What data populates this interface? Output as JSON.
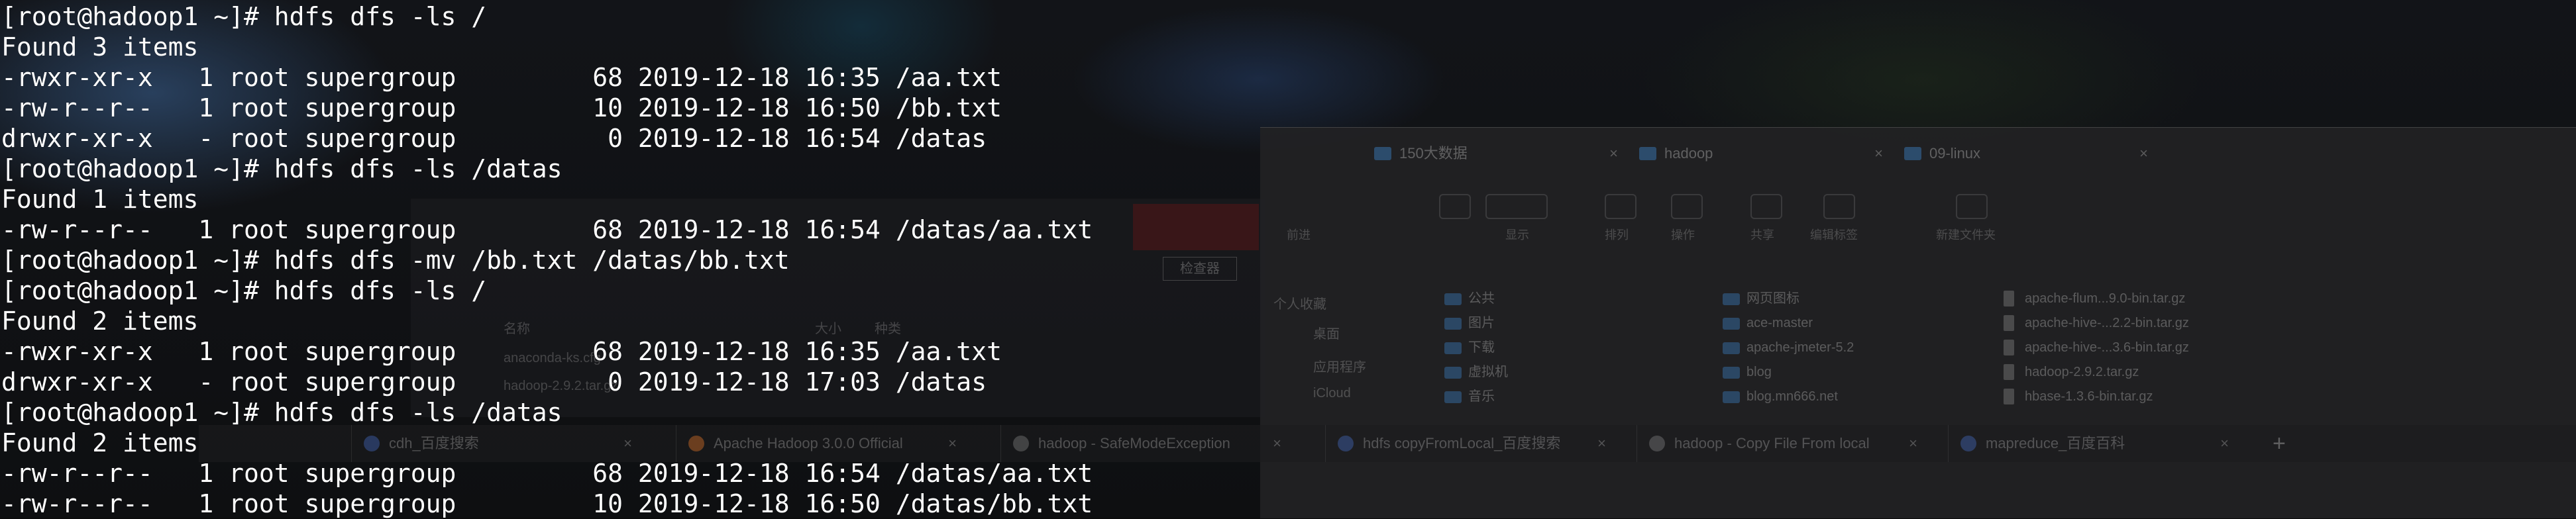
{
  "terminal": {
    "lines": [
      "[root@hadoop1 ~]# hdfs dfs -ls /",
      "Found 3 items",
      "-rwxr-xr-x   1 root supergroup         68 2019-12-18 16:35 /aa.txt",
      "-rw-r--r--   1 root supergroup         10 2019-12-18 16:50 /bb.txt",
      "drwxr-xr-x   - root supergroup          0 2019-12-18 16:54 /datas",
      "[root@hadoop1 ~]# hdfs dfs -ls /datas",
      "Found 1 items",
      "-rw-r--r--   1 root supergroup         68 2019-12-18 16:54 /datas/aa.txt",
      "[root@hadoop1 ~]# hdfs dfs -mv /bb.txt /datas/bb.txt",
      "[root@hadoop1 ~]# hdfs dfs -ls /",
      "Found 2 items",
      "-rwxr-xr-x   1 root supergroup         68 2019-12-18 16:35 /aa.txt",
      "drwxr-xr-x   - root supergroup          0 2019-12-18 17:03 /datas",
      "[root@hadoop1 ~]# hdfs dfs -ls /datas",
      "Found 2 items",
      "-rw-r--r--   1 root supergroup         68 2019-12-18 16:54 /datas/aa.txt",
      "-rw-r--r--   1 root supergroup         10 2019-12-18 16:50 /datas/bb.txt"
    ]
  },
  "finder": {
    "tabs": [
      "150大数据",
      "hadoop",
      "09-linux"
    ],
    "toolbar": [
      "前进",
      "显示",
      "排列",
      "操作",
      "共享",
      "编辑标签",
      "新建文件夹"
    ],
    "sidebar": [
      "个人收藏",
      "桌面",
      "应用程序",
      "iCloud"
    ],
    "col1": [
      "公共",
      "图片",
      "下载",
      "虚拟机",
      "音乐"
    ],
    "col2": [
      "网页图标",
      "ace-master",
      "apache-jmeter-5.2",
      "blog",
      "blog.mn666.net"
    ],
    "col3": [
      "apache-flum...9.0-bin.tar.gz",
      "apache-hive-...2.2-bin.tar.gz",
      "apache-hive-...3.6-bin.tar.gz",
      "hadoop-2.9.2.tar.gz",
      "hbase-1.3.6-bin.tar.gz"
    ]
  },
  "editor": {
    "check_button": "检查器",
    "header_name": "名称",
    "header_size": "大小",
    "header_kind": "种类",
    "files": [
      "anaconda-ks.cfg",
      "hadoop-2.9.2.tar.gz"
    ]
  },
  "browser": {
    "tabs": [
      "cdh_百度搜索",
      "Apache Hadoop 3.0.0 Official",
      "hadoop - SafeModeException",
      "hdfs copyFromLocal_百度搜索",
      "hadoop - Copy File From local",
      "mapreduce_百度百科"
    ],
    "new_tab": "+"
  }
}
